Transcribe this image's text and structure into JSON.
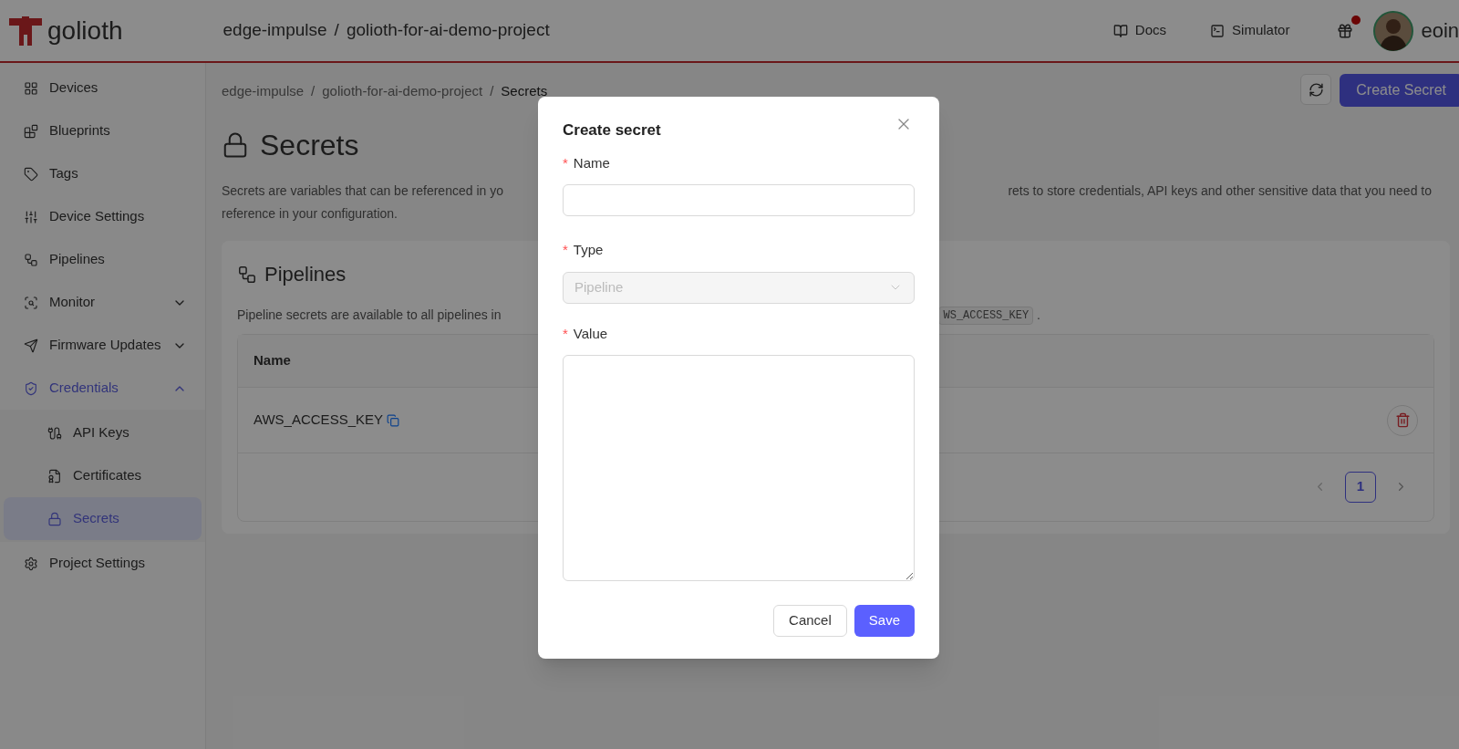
{
  "header": {
    "logo": "golioth",
    "org": "edge-impulse",
    "separator": "/",
    "project": "golioth-for-ai-demo-project",
    "links": [
      {
        "label": "Docs"
      },
      {
        "label": "Simulator"
      }
    ],
    "notification": true,
    "user": "eoin"
  },
  "sidebar": {
    "items": [
      {
        "label": "Devices",
        "selected": false
      },
      {
        "label": "Blueprints",
        "selected": false
      },
      {
        "label": "Tags",
        "selected": false
      },
      {
        "label": "Device Settings",
        "selected": false
      },
      {
        "label": "Pipelines",
        "selected": false
      },
      {
        "label": "Monitor",
        "selected": false,
        "expanded": false
      },
      {
        "label": "Firmware Updates",
        "selected": false,
        "expanded": false
      },
      {
        "label": "Credentials",
        "selected": false,
        "expanded": true,
        "children": [
          {
            "label": "API Keys",
            "selected": false
          },
          {
            "label": "Certificates",
            "selected": false
          },
          {
            "label": "Secrets",
            "selected": true
          }
        ]
      },
      {
        "label": "Project Settings",
        "selected": false
      }
    ]
  },
  "page": {
    "breadcrumb": [
      "edge-impulse",
      "golioth-for-ai-demo-project",
      "Secrets"
    ],
    "breadcrumb_separator": "/",
    "title": "Secrets",
    "create_button": "Create Secret",
    "description_lines": [
      {
        "left": "Secrets are variables that can be referenced in yo",
        "right": "rets to store credentials, API keys and other sensitive data that you need to"
      },
      {
        "left": "reference in your configuration."
      }
    ]
  },
  "pipelines": {
    "title": "Pipelines",
    "description": "Pipeline secrets are available to all pipelines in",
    "description_code": "WS_ACCESS_KEY",
    "description_end": ".",
    "table": {
      "columns": [
        "Name"
      ],
      "rows": [
        {
          "name": "AWS_ACCESS_KEY"
        }
      ]
    },
    "pagination": {
      "pages": [
        {
          "label": "1",
          "selected": true
        }
      ]
    }
  },
  "dialog": {
    "title": "Create secret",
    "required_mark": "*",
    "fields": [
      {
        "kind": "text",
        "label": "Name",
        "required": true
      },
      {
        "kind": "select",
        "label": "Type",
        "required": true,
        "value": "Pipeline",
        "disabled": true
      },
      {
        "kind": "textarea",
        "label": "Value",
        "required": true
      }
    ],
    "buttons": [
      {
        "label": "Cancel",
        "kind": "secondary"
      },
      {
        "label": "Save",
        "kind": "primary"
      }
    ]
  }
}
